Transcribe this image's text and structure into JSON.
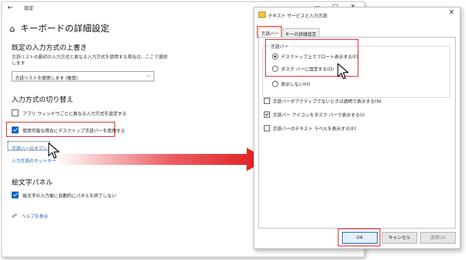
{
  "settings": {
    "back_glyph": "←",
    "title": "設定",
    "minimize": "—",
    "maximize": "□",
    "close": "✕",
    "home_glyph": "⌂",
    "heading": "キーボードの詳細設定",
    "override_section": {
      "title": "既定の入力方式の上書き",
      "description": "言語リストの最初の入力方式と異なる入力方式を使用する場合は、ここで選択します",
      "dropdown_value": "言語リストを使用します (推奨)",
      "dropdown_arrow": "⌵"
    },
    "switch_section": {
      "title": "入力方式の切り替え",
      "per_app_checkbox": "アプリ ウィンドウごとに異なる入力方式を設定する",
      "desktop_bar_checkbox": "使用可能な場合にデスクトップ言語バーを使用する",
      "langbar_options_link": "言語バーのオプション",
      "hotkeys_link": "入力言語のホットキー"
    },
    "emoji_section": {
      "title": "絵文字パネル",
      "checkbox": "絵文字の入力後に自動的にパネルを終了しない"
    },
    "help_link": "ヘルプを表示"
  },
  "dialog": {
    "title": "テキスト サービスと入力言語",
    "close": "✕",
    "tabs": [
      "言語バー",
      "キーの詳細設定"
    ],
    "group_label": "言語バー",
    "radios": [
      {
        "label": "デスクトップ上でフロート表示する(F)",
        "checked": true
      },
      {
        "label": "タスク バーに固定する(D)",
        "checked": false
      },
      {
        "label": "表示しない(H)",
        "checked": false
      }
    ],
    "checkboxes": [
      {
        "label": "言語バーがアクティブでないときは透明で表示する(N)",
        "checked": false
      },
      {
        "label": "言語バー アイコンをタスク バーで表示する(I)",
        "checked": true
      },
      {
        "label": "言語バーのテキスト ラベルを表示する(E)",
        "checked": false
      }
    ],
    "buttons": {
      "ok": "OK",
      "cancel": "キャンセル",
      "apply": "適用(A)"
    }
  },
  "colors": {
    "highlight_red": "#e1191c",
    "link_blue": "#0b5fb8",
    "accent_blue": "#0b63c9"
  }
}
